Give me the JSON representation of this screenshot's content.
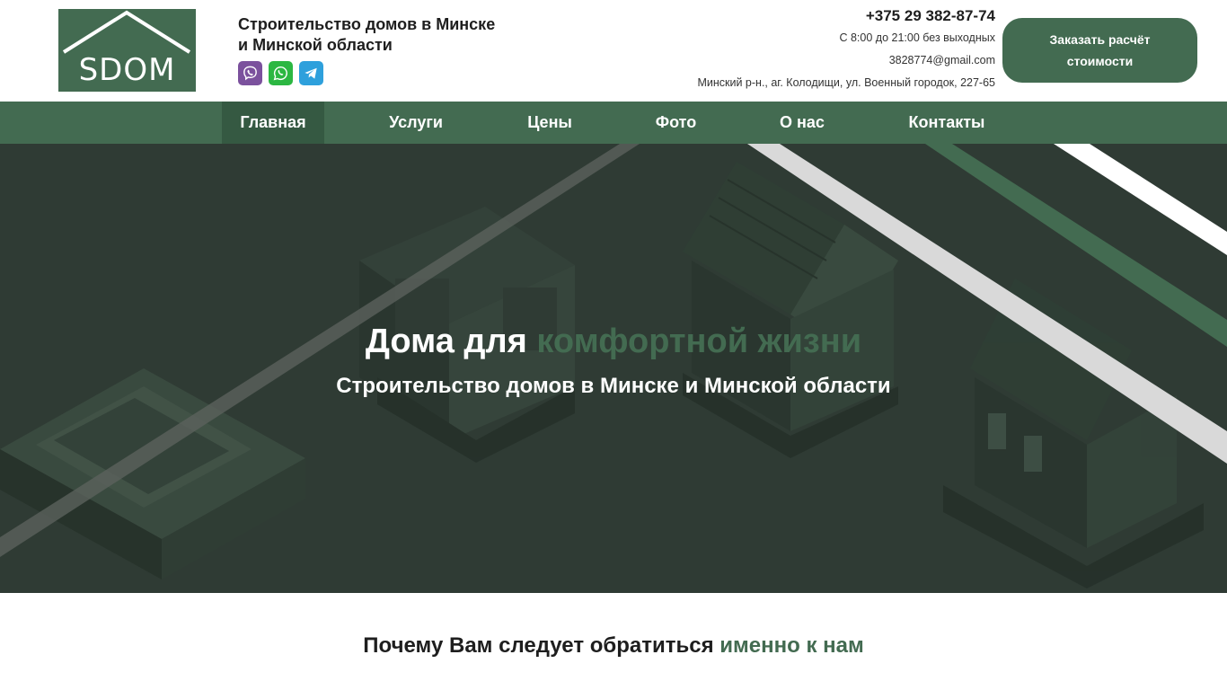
{
  "brand": {
    "logo_text": "SDOM"
  },
  "header": {
    "tagline_line1": "Строительство домов в Минске",
    "tagline_line2": "и Минской области",
    "messengers": [
      {
        "icon": "viber-icon",
        "color": "#7b519d"
      },
      {
        "icon": "whatsapp-icon",
        "color": "#2cb742"
      },
      {
        "icon": "telegram-icon",
        "color": "#2ea0dc"
      }
    ],
    "phone": "+375 29 382-87-74",
    "hours": "С 8:00 до 21:00 без выходных",
    "email": "3828774@gmail.com",
    "address": "Минский р-н., аг. Колодищи, ул. Военный городок, 227-65",
    "order_button": "Заказать расчёт стоимости"
  },
  "nav": {
    "items": [
      {
        "label": "Главная",
        "active": true
      },
      {
        "label": "Услуги",
        "active": false
      },
      {
        "label": "Цены",
        "active": false
      },
      {
        "label": "Фото",
        "active": false
      },
      {
        "label": "О нас",
        "active": false
      },
      {
        "label": "Контакты",
        "active": false
      }
    ]
  },
  "hero": {
    "title_part1": "Дома для ",
    "title_accent": "комфортной жизни",
    "subtitle": "Строительство домов в Минске и Минской области"
  },
  "why": {
    "title_part1": "Почему Вам следует обратиться ",
    "title_accent": "именно к нам"
  },
  "colors": {
    "brand_green": "#436b51",
    "nav_active": "#355942",
    "hero_bg": "#2f3b34",
    "text_dark": "#1e1e1e"
  }
}
